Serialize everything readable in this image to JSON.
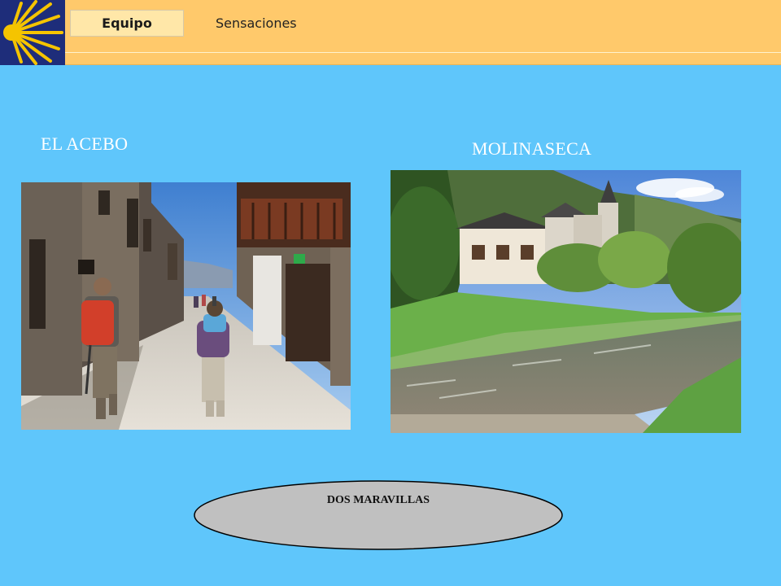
{
  "header": {
    "tabs": [
      {
        "label": "Equipo",
        "active": true
      },
      {
        "label": "Sensaciones",
        "active": false
      }
    ],
    "logo": {
      "icon": "scallop-shell-icon",
      "colors": {
        "background": "#1e2d7a",
        "shell": "#f5c400"
      }
    }
  },
  "main": {
    "left": {
      "caption": "EL ACEBO",
      "image": "stone-village-street-with-hikers"
    },
    "right": {
      "caption": "MOLINASECA",
      "image": "river-and-village-with-church"
    }
  },
  "footer": {
    "oval_label": "DOS MARAVILLAS"
  },
  "colors": {
    "page_background": "#5fc6fb",
    "header_background": "#ffc96b",
    "caption_text": "#ffffff",
    "oval_fill": "#c0c0c0"
  }
}
